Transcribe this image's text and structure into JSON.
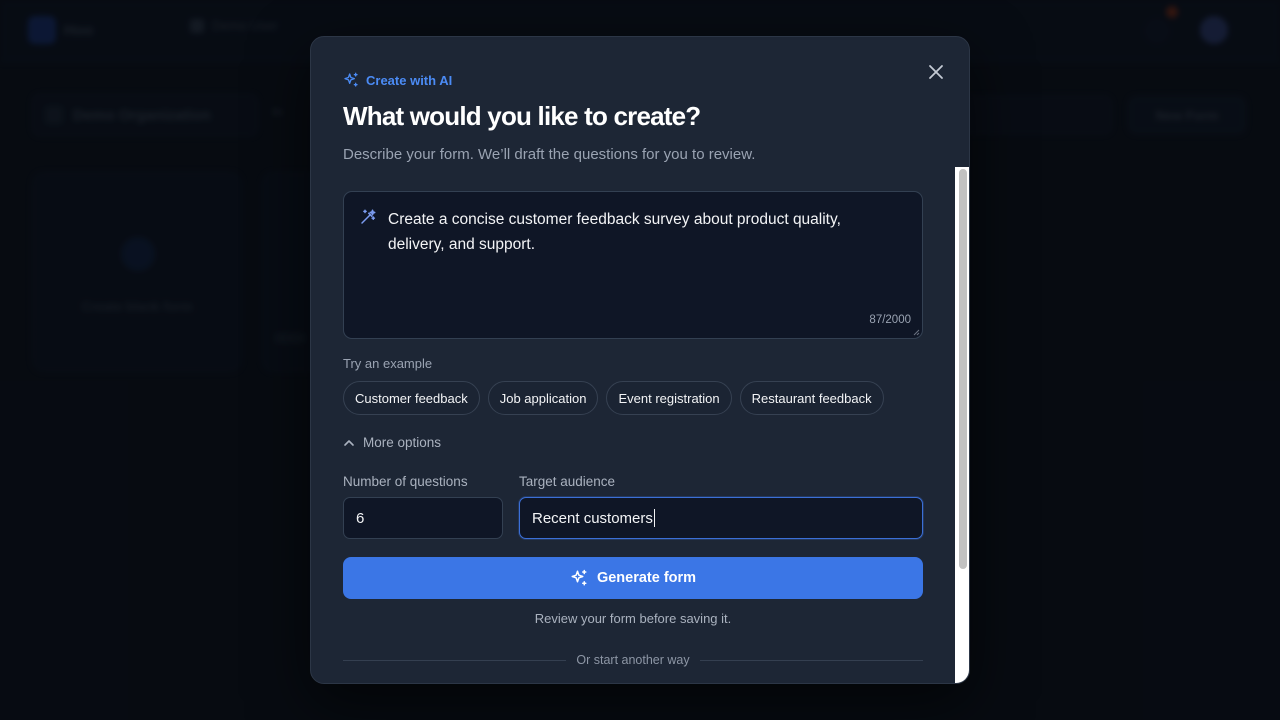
{
  "background": {
    "logo_text": "Hoo",
    "nav_label": "Demo User",
    "org_name": "Demo Organization",
    "filter_label": "In",
    "new_form_label": "New Form",
    "blank_card_label": "Create blank form"
  },
  "modal": {
    "eyebrow": "Create with AI",
    "title": "What would you like to create?",
    "subtitle": "Describe your form. We’ll draft the questions for you to review.",
    "prompt": {
      "value": "Create a concise customer feedback survey about product quality, delivery, and support.",
      "char_count": "87/2000"
    },
    "examples_label": "Try an example",
    "examples": [
      "Customer feedback",
      "Job application",
      "Event registration",
      "Restaurant feedback"
    ],
    "more_options_label": "More options",
    "fields": {
      "questions_label": "Number of questions",
      "questions_value": "6",
      "audience_label": "Target audience",
      "audience_value": "Recent customers"
    },
    "generate_label": "Generate form",
    "review_note": "Review your form before saving it.",
    "divider_text": "Or start another way"
  },
  "colors": {
    "accent": "#3b76e6",
    "eyebrow": "#4b8bf5",
    "modal_bg": "#1d2635",
    "page_bg": "#0b0f17"
  },
  "icons": {
    "eyebrow": "sparkles-icon",
    "prompt": "magic-wand-icon",
    "close": "close-icon",
    "more_options": "chevron-up-icon",
    "generate": "sparkles-icon"
  }
}
